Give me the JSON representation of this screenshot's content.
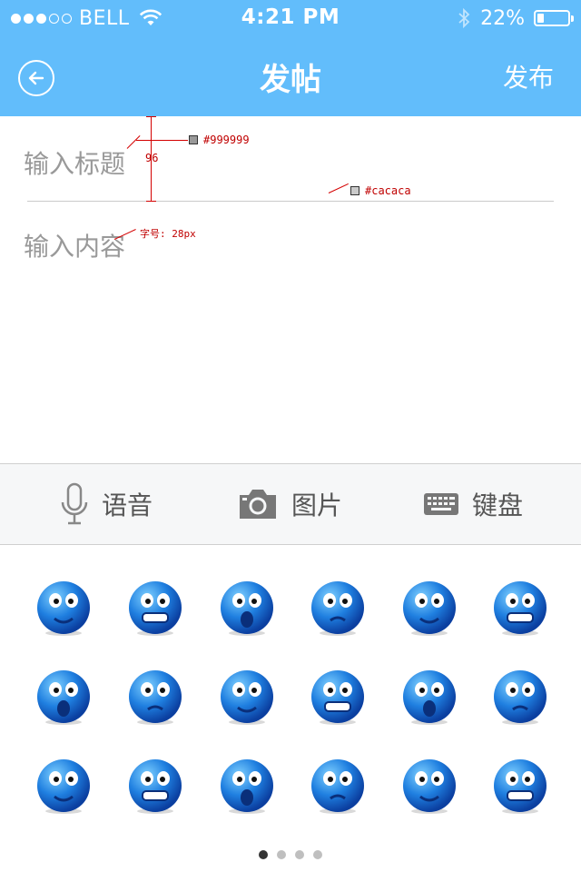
{
  "status_bar": {
    "signal_filled": 3,
    "signal_total": 5,
    "carrier": "BELL",
    "time": "4:21 PM",
    "battery_text": "22%",
    "battery_level": 0.22
  },
  "nav": {
    "back_icon": "back-arrow-icon",
    "title": "发帖",
    "publish_label": "发布",
    "bg_color": "#62bdfb"
  },
  "compose": {
    "title_placeholder": "输入标题",
    "content_placeholder": "输入内容",
    "divider_color": "#cacaca",
    "placeholder_color": "#999999"
  },
  "annotations": {
    "height_label": "96",
    "placeholder_color_label": "#999999",
    "divider_color_label": "#cacaca",
    "font_size_label": "字号: 28px"
  },
  "toolbar": {
    "voice_label": "语音",
    "image_label": "图片",
    "keyboard_label": "键盘"
  },
  "emoji_panel": {
    "emojis": [
      "shrug-emoji",
      "wave-grin-emoji",
      "heart-hold-emoji",
      "scream-emoji",
      "shocked-emoji",
      "sick-emoji",
      "blush-sparkle-emoji",
      "cover-mouth-emoji",
      "teary-eyes-emoji",
      "hand-face-emoji",
      "pout-emoji",
      "yawn-emoji",
      "fang-shout-emoji",
      "missing-tooth-emoji",
      "sunglasses-emoji",
      "nervous-grin-emoji",
      "rose-emoji",
      "squint-blush-emoji"
    ],
    "page_count": 4,
    "active_page": 0
  }
}
